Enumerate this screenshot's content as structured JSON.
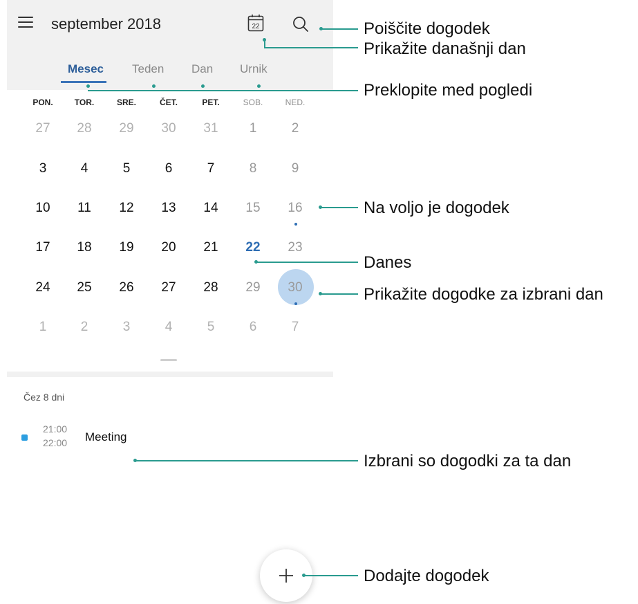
{
  "header": {
    "title": "september 2018",
    "today_icon_number": "22",
    "menu_icon": "menu-icon",
    "today_icon": "calendar-today-icon",
    "search_icon": "search-icon"
  },
  "tabs": [
    {
      "label": "Mesec",
      "active": true
    },
    {
      "label": "Teden",
      "active": false
    },
    {
      "label": "Dan",
      "active": false
    },
    {
      "label": "Urnik",
      "active": false
    }
  ],
  "weekdays": [
    "PON.",
    "TOR.",
    "SRE.",
    "ČET.",
    "PET.",
    "SOB.",
    "NED."
  ],
  "weeks": [
    [
      "27",
      "28",
      "29",
      "30",
      "31",
      "1",
      "2"
    ],
    [
      "3",
      "4",
      "5",
      "6",
      "7",
      "8",
      "9"
    ],
    [
      "10",
      "11",
      "12",
      "13",
      "14",
      "15",
      "16"
    ],
    [
      "17",
      "18",
      "19",
      "20",
      "21",
      "22",
      "23"
    ],
    [
      "24",
      "25",
      "26",
      "27",
      "28",
      "29",
      "30"
    ],
    [
      "1",
      "2",
      "3",
      "4",
      "5",
      "6",
      "7"
    ]
  ],
  "today_day": "22",
  "selected_day": "30",
  "days_with_events": [
    "16",
    "30"
  ],
  "events_section": {
    "heading": "Čez 8 dni",
    "events": [
      {
        "start": "21:00",
        "end": "22:00",
        "title": "Meeting",
        "color": "#2c9ee0"
      }
    ]
  },
  "fab_icon": "plus-icon",
  "callouts": {
    "search": "Poiščite dogodek",
    "today": "Prikažite današnji dan",
    "switch_views": "Preklopite med pogledi",
    "has_event": "Na voljo je dogodek",
    "today_marker": "Danes",
    "show_selected": "Prikažite dogodke za izbrani dan",
    "selected_events": "Izbrani so dogodki za ta dan",
    "add_event": "Dodajte dogodek"
  },
  "colors": {
    "accent": "#2e6db3",
    "callout_line": "#2a9b8f",
    "selected_circle": "#bcd6f0",
    "panel_bg": "#f1f1f1"
  }
}
